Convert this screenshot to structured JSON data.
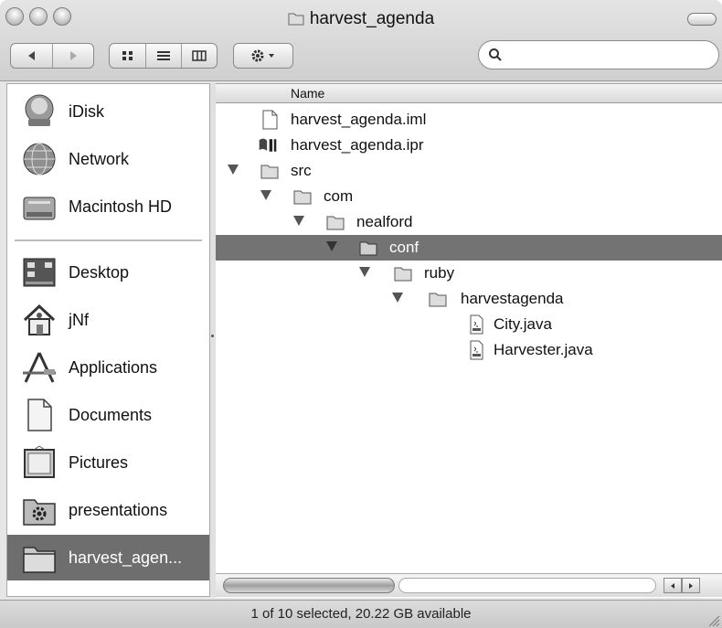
{
  "window": {
    "title": "harvest_agenda"
  },
  "toolbar": {
    "back_icon": "back-arrow-icon",
    "forward_icon": "forward-arrow-icon",
    "view_icons": [
      "icon-view-icon",
      "list-view-icon",
      "column-view-icon"
    ],
    "action_icon": "gear-icon",
    "search_placeholder": ""
  },
  "sidebar": {
    "items": [
      {
        "label": "iDisk",
        "icon": "idisk-icon"
      },
      {
        "label": "Network",
        "icon": "network-globe-icon"
      },
      {
        "label": "Macintosh HD",
        "icon": "hard-drive-icon"
      },
      {
        "label": "Desktop",
        "icon": "desktop-icon"
      },
      {
        "label": "jNf",
        "icon": "home-icon"
      },
      {
        "label": "Applications",
        "icon": "applications-icon"
      },
      {
        "label": "Documents",
        "icon": "document-icon"
      },
      {
        "label": "Pictures",
        "icon": "pictures-icon"
      },
      {
        "label": "presentations",
        "icon": "gear-folder-icon"
      },
      {
        "label": "harvest_agen...",
        "icon": "folder-icon",
        "selected": true
      }
    ]
  },
  "list": {
    "column_header": "Name",
    "rows": [
      {
        "label": "harvest_agenda.iml",
        "depth": 0,
        "type": "file",
        "expanded": null
      },
      {
        "label": "harvest_agenda.ipr",
        "depth": 0,
        "type": "project",
        "expanded": null
      },
      {
        "label": "src",
        "depth": 0,
        "type": "folder",
        "expanded": true
      },
      {
        "label": "com",
        "depth": 1,
        "type": "folder",
        "expanded": true
      },
      {
        "label": "nealford",
        "depth": 2,
        "type": "folder",
        "expanded": true
      },
      {
        "label": "conf",
        "depth": 3,
        "type": "folder",
        "expanded": true,
        "selected": true
      },
      {
        "label": "ruby",
        "depth": 4,
        "type": "folder",
        "expanded": true
      },
      {
        "label": "harvestagenda",
        "depth": 5,
        "type": "folder",
        "expanded": true
      },
      {
        "label": "City.java",
        "depth": 6,
        "type": "java",
        "expanded": null
      },
      {
        "label": "Harvester.java",
        "depth": 6,
        "type": "java",
        "expanded": null
      }
    ]
  },
  "status": {
    "text": "1 of 10 selected, 20.22 GB available"
  },
  "colors": {
    "selection": "#737373",
    "chrome": "#d8d8d8"
  }
}
